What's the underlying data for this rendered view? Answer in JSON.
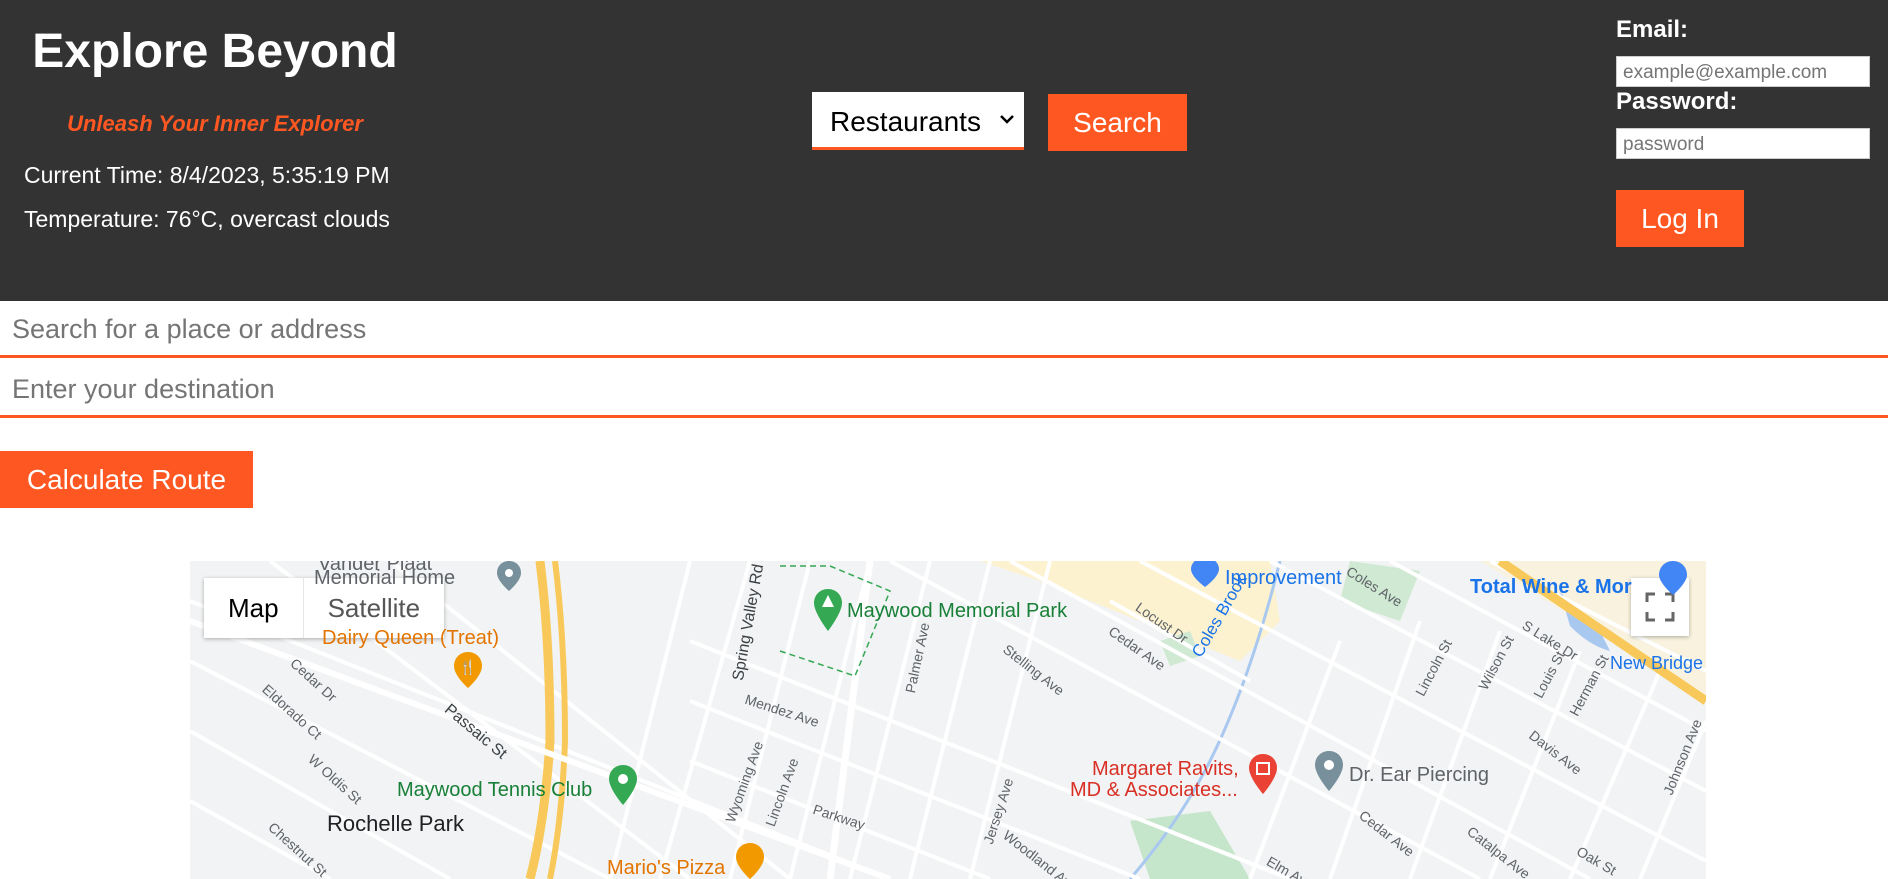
{
  "header": {
    "title": "Explore Beyond",
    "tagline": "Unleash Your Inner Explorer",
    "current_time": "Current Time: 8/4/2023, 5:35:19 PM",
    "temperature": "Temperature: 76°C, overcast clouds",
    "category_select": "Restaurants",
    "search_label": "Search",
    "email_label": "Email:",
    "email_placeholder": "example@example.com",
    "password_label": "Password:",
    "password_placeholder": "password",
    "login_label": "Log In"
  },
  "search": {
    "place_placeholder": "Search for a place or address",
    "destination_placeholder": "Enter your destination",
    "route_label": "Calculate Route"
  },
  "map": {
    "type_map": "Map",
    "type_satellite": "Satellite",
    "pois": {
      "vander_plaat": "Vander Plaat",
      "memorial_home": "Memorial Home",
      "dairy_queen": "Dairy Queen (Treat)",
      "maywood_memorial_park": "Maywood Memorial Park",
      "improvement": "Improvement",
      "total_wine": "Total Wine & Mor",
      "new_bridge": "New Bridge",
      "maywood_tennis": "Maywood Tennis Club",
      "margaret_ravits_1": "Margaret Ravits,",
      "margaret_ravits_2": "MD & Associates...",
      "dr_ear": "Dr. Ear Piercing",
      "rochelle_park": "Rochelle Park",
      "marios_pizza": "Mario's Pizza",
      "coles_brook": "Coles Brook"
    },
    "streets": {
      "spring_valley": "Spring Valley Rd",
      "passaic": "Passaic St",
      "mendez": "Mendez Ave",
      "palmer": "Palmer Ave",
      "stelling": "Stelling Ave",
      "cedar_ave": "Cedar Ave",
      "locust": "Locust Dr",
      "coles_ave": "Coles Ave",
      "lincoln_st": "Lincoln St",
      "wilson": "Wilson St",
      "s_lake": "S Lake Dr",
      "louis": "Louis St",
      "herman": "Herman St",
      "davis": "Davis Ave",
      "johnson": "Johnson Ave",
      "eldorado": "Eldorado Ct",
      "cedar_dr": "Cedar Dr",
      "w_oldis": "W Oldis St",
      "chestnut": "Chestnut St",
      "wyoming": "Wyoming Ave",
      "lincoln_ave": "Lincoln Ave",
      "parkway": "Parkway",
      "jersey": "Jersey Ave",
      "woodland": "Woodland Ave",
      "cedar_ave_2": "Cedar Ave",
      "catalpa": "Catalpa Ave",
      "oak": "Oak St",
      "elm": "Elm Ave"
    }
  },
  "colors": {
    "accent": "#ff5722",
    "header_bg": "#333333"
  },
  "icons": [
    "chevron-down-icon",
    "fullscreen-icon",
    "restaurant-pin-icon",
    "park-pin-icon",
    "medical-pin-icon",
    "location-pin-icon"
  ]
}
